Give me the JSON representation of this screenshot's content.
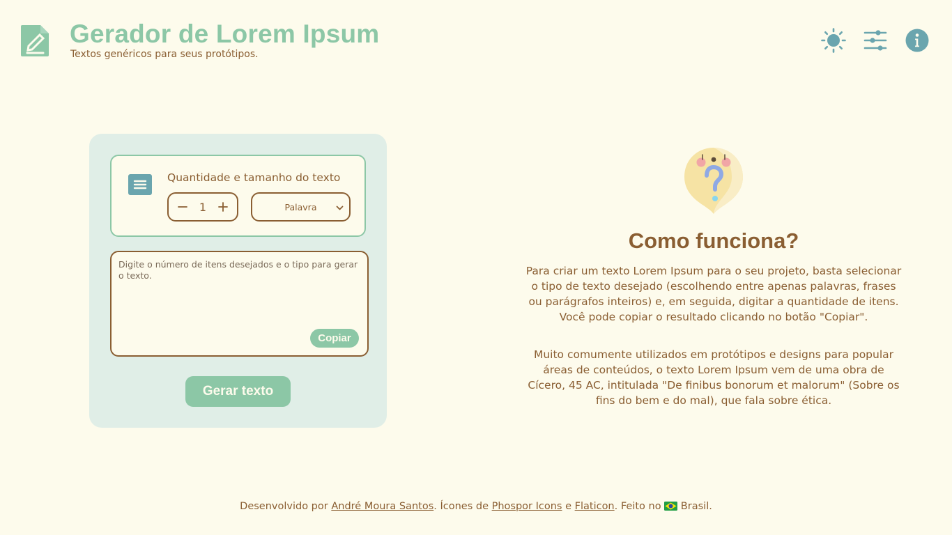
{
  "header": {
    "title": "Gerador de Lorem Ipsum",
    "subtitle": "Textos genéricos para seus protótipos.",
    "icons": [
      "notebook-pencil-icon",
      "sun-icon",
      "sliders-icon",
      "info-icon"
    ]
  },
  "generator": {
    "config_label": "Quantidade e tamanho do texto",
    "quantity": "1",
    "size_selected": "Palavra",
    "output_placeholder": "Digite o número de itens desejados e o tipo para gerar o texto.",
    "copy_label": "Copiar",
    "generate_label": "Gerar texto"
  },
  "how": {
    "title": "Como funciona?",
    "p1": "Para criar um texto Lorem Ipsum para o seu projeto, basta selecionar o tipo de texto desejado (escolhendo entre apenas palavras, frases ou parágrafos inteiros) e, em seguida, digitar a quantidade de itens. Você pode copiar o resultado clicando no botão \"Copiar\".",
    "p2": "Muito comumente utilizados em protótipos e designs para popular áreas de conteúdos, o texto Lorem Ipsum vem de uma obra de Cícero, 45 AC, intitulada \"De finibus bonorum et malorum\" (Sobre os fins do bem e do mal), que fala sobre ética."
  },
  "footer": {
    "t1": "Desenvolvido por ",
    "author": "André Moura Santos",
    "t2": ". Ícones de ",
    "phosphor": "Phospor Icons",
    "t3": " e ",
    "flaticon": "Flaticon",
    "t4": ". Feito no ",
    "t5": " Brasil."
  },
  "colors": {
    "background": "#fdfbec",
    "accent_green": "#8cc7a6",
    "brown": "#8a5e32",
    "icon_teal": "#6aa5ae",
    "panel": "#e0eee7"
  }
}
